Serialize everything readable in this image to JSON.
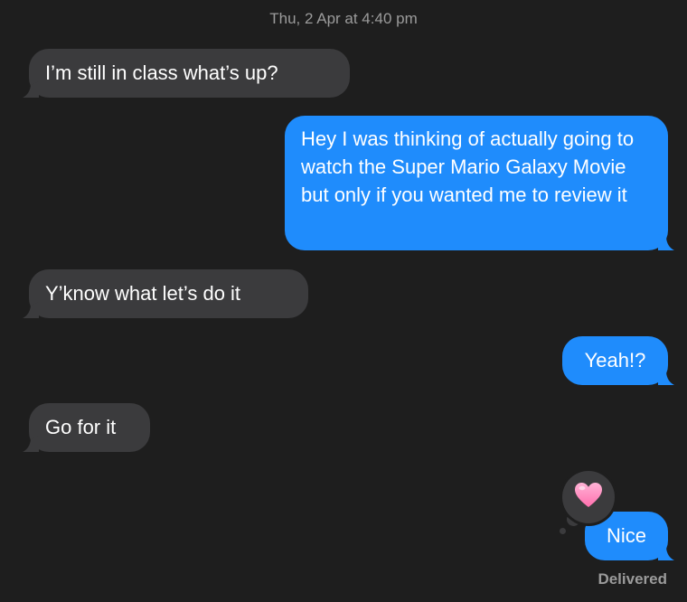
{
  "conversation": {
    "timestamp": "Thu, 2 Apr at 4:40 pm",
    "messages": [
      {
        "direction": "incoming",
        "text": "I’m still in class what’s up?"
      },
      {
        "direction": "outgoing",
        "text": "Hey I was thinking of actually going to watch the Super Mario Galaxy Movie but only if you wanted me to review it"
      },
      {
        "direction": "incoming",
        "text": "Y’know what let’s do it"
      },
      {
        "direction": "outgoing",
        "text": "Yeah!?"
      },
      {
        "direction": "incoming",
        "text": "Go for it"
      },
      {
        "direction": "outgoing",
        "text": "Nice",
        "reaction": "pink-heart-icon"
      }
    ],
    "status": "Delivered"
  },
  "colors": {
    "background": "#1e1e1e",
    "incoming_bubble": "#3b3b3d",
    "outgoing_bubble": "#1f8cfc",
    "meta_text": "#9b9b9b",
    "heart": "#ff8fc4"
  }
}
